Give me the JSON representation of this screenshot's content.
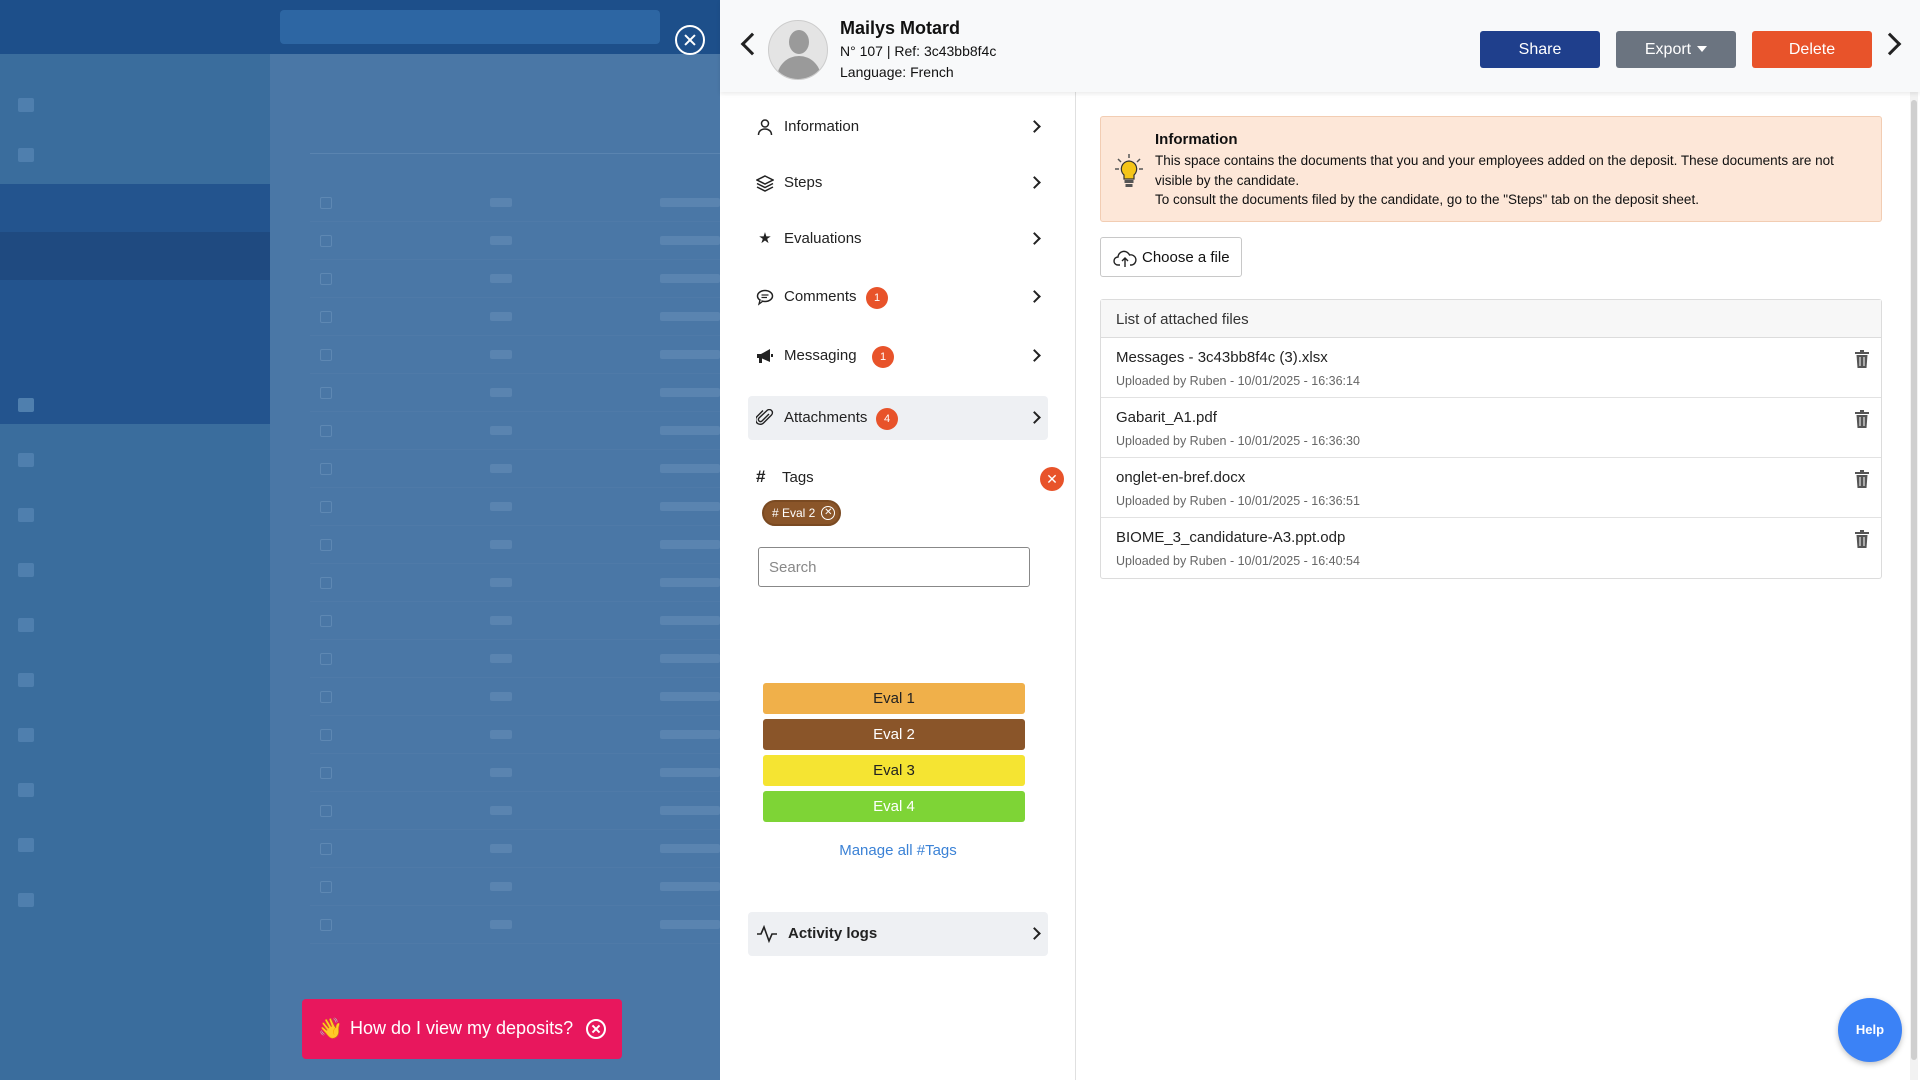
{
  "background_toast": {
    "emoji": "👋",
    "text": "How do I view my deposits?"
  },
  "candidate": {
    "name": "Mailys Motard",
    "ref_line": "N° 107 | Ref: 3c43bb8f4c",
    "language_line": "Language: French"
  },
  "header_buttons": {
    "share": "Share",
    "export": "Export",
    "delete": "Delete"
  },
  "menu": {
    "items": [
      {
        "label": "Information",
        "icon": "user-icon",
        "badge": ""
      },
      {
        "label": "Steps",
        "icon": "layers-icon",
        "badge": ""
      },
      {
        "label": "Evaluations",
        "icon": "stars-icon",
        "badge": ""
      },
      {
        "label": "Comments",
        "icon": "comment-icon",
        "badge": "1"
      },
      {
        "label": "Messaging",
        "icon": "megaphone-icon",
        "badge": "1"
      },
      {
        "label": "Attachments",
        "icon": "paperclip-icon",
        "badge": "4"
      }
    ],
    "tags_label": "Tags",
    "selected_tag": "# Eval 2",
    "tag_search_placeholder": "Search",
    "tag_options": [
      {
        "label": "Eval 1",
        "color": "#f0b04a",
        "text_color": "#222222"
      },
      {
        "label": "Eval 2",
        "color": "#8a5529",
        "text_color": "#ffffff"
      },
      {
        "label": "Eval 3",
        "color": "#f5e432",
        "text_color": "#222222"
      },
      {
        "label": "Eval 4",
        "color": "#7ed436",
        "text_color": "#ffffff"
      }
    ],
    "manage_tags": "Manage all #Tags",
    "activity_logs": "Activity logs"
  },
  "info": {
    "title": "Information",
    "text": "This space contains the documents that you and your employees added on the deposit. These documents are not visible by the candidate.",
    "text2": "To consult the documents filed by the candidate, go to the \"Steps\" tab on the deposit sheet."
  },
  "upload": {
    "label": "Choose a file"
  },
  "files": {
    "header": "List of attached files",
    "rows": [
      {
        "name": "Messages - 3c43bb8f4c (3).xlsx",
        "meta": "Uploaded by Ruben - 10/01/2025 - 16:36:14"
      },
      {
        "name": "Gabarit_A1.pdf",
        "meta": "Uploaded by Ruben - 10/01/2025 - 16:36:30"
      },
      {
        "name": "onglet-en-bref.docx",
        "meta": "Uploaded by Ruben - 10/01/2025 - 16:36:51"
      },
      {
        "name": "BIOME_3_candidature-A3.ppt.odp",
        "meta": "Uploaded by Ruben - 10/01/2025 - 16:40:54"
      }
    ]
  },
  "help_button": "Help",
  "colors": {
    "accent_blue": "#1f3f8c",
    "danger": "#e8532a",
    "gray_button": "#6b7480",
    "toast": "#e8175d"
  }
}
